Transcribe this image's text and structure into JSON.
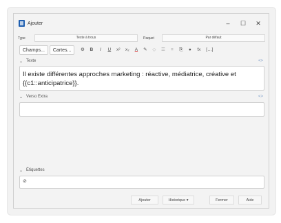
{
  "window": {
    "title": "Ajouter"
  },
  "top_row": {
    "type_label": "Type",
    "type_value": "Texte à trous",
    "deck_label": "Paquet",
    "deck_value": "Par défaut"
  },
  "toolbar": {
    "fields_button": "Champs...",
    "cards_button": "Cartes..."
  },
  "fields": [
    {
      "name": "Texte",
      "content": "Il existe différentes approches marketing : réactive, médiatrice, créative et {{c1::anticipatrice}}."
    },
    {
      "name": "Verso Extra",
      "content": ""
    }
  ],
  "tags": {
    "label": "Étiquettes"
  },
  "buttons": {
    "add": "Ajouter",
    "history": "Historique ▾",
    "close": "Fermer",
    "help": "Aide"
  },
  "icons": {
    "gear": "⚙",
    "bold": "B",
    "italic": "I",
    "underline": "U",
    "superscript": "x²",
    "subscript": "x₂",
    "text_color": "A",
    "highlight": "✎",
    "eraser": "◇",
    "list_ul": "☰",
    "list_ol": "≡",
    "paperclip": "⎘",
    "record": "●",
    "math": "fx",
    "cloze": "[…]",
    "html": "<>",
    "pin": "⇕",
    "tag": "⊘"
  }
}
